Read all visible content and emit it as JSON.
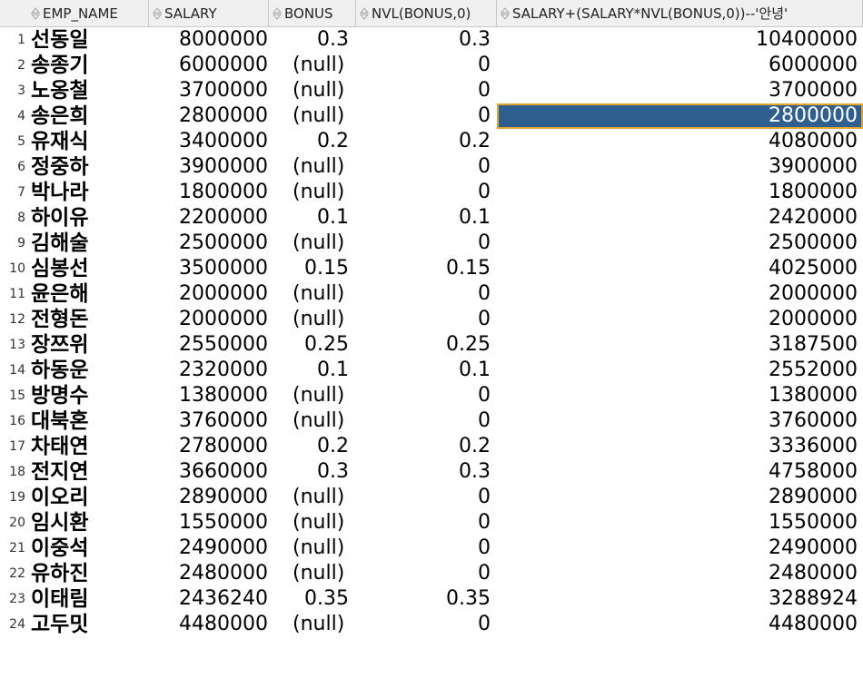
{
  "columns": [
    {
      "key": "name",
      "label": "EMP_NAME"
    },
    {
      "key": "salary",
      "label": "SALARY"
    },
    {
      "key": "bonus",
      "label": "BONUS"
    },
    {
      "key": "nvl",
      "label": "NVL(BONUS,0)"
    },
    {
      "key": "expr",
      "label": "SALARY+(SALARY*NVL(BONUS,0))--'안녕'"
    }
  ],
  "selected_row": 4,
  "rows": [
    {
      "num": "1",
      "name": "선동일",
      "salary": "8000000",
      "bonus": "0.3",
      "nvl": "0.3",
      "expr": "10400000"
    },
    {
      "num": "2",
      "name": "송종기",
      "salary": "6000000",
      "bonus": "(null)",
      "nvl": "0",
      "expr": "6000000"
    },
    {
      "num": "3",
      "name": "노옹철",
      "salary": "3700000",
      "bonus": "(null)",
      "nvl": "0",
      "expr": "3700000"
    },
    {
      "num": "4",
      "name": "송은희",
      "salary": "2800000",
      "bonus": "(null)",
      "nvl": "0",
      "expr": "2800000"
    },
    {
      "num": "5",
      "name": "유재식",
      "salary": "3400000",
      "bonus": "0.2",
      "nvl": "0.2",
      "expr": "4080000"
    },
    {
      "num": "6",
      "name": "정중하",
      "salary": "3900000",
      "bonus": "(null)",
      "nvl": "0",
      "expr": "3900000"
    },
    {
      "num": "7",
      "name": "박나라",
      "salary": "1800000",
      "bonus": "(null)",
      "nvl": "0",
      "expr": "1800000"
    },
    {
      "num": "8",
      "name": "하이유",
      "salary": "2200000",
      "bonus": "0.1",
      "nvl": "0.1",
      "expr": "2420000"
    },
    {
      "num": "9",
      "name": "김해술",
      "salary": "2500000",
      "bonus": "(null)",
      "nvl": "0",
      "expr": "2500000"
    },
    {
      "num": "10",
      "name": "심봉선",
      "salary": "3500000",
      "bonus": "0.15",
      "nvl": "0.15",
      "expr": "4025000"
    },
    {
      "num": "11",
      "name": "윤은해",
      "salary": "2000000",
      "bonus": "(null)",
      "nvl": "0",
      "expr": "2000000"
    },
    {
      "num": "12",
      "name": "전형돈",
      "salary": "2000000",
      "bonus": "(null)",
      "nvl": "0",
      "expr": "2000000"
    },
    {
      "num": "13",
      "name": "장쯔위",
      "salary": "2550000",
      "bonus": "0.25",
      "nvl": "0.25",
      "expr": "3187500"
    },
    {
      "num": "14",
      "name": "하동운",
      "salary": "2320000",
      "bonus": "0.1",
      "nvl": "0.1",
      "expr": "2552000"
    },
    {
      "num": "15",
      "name": "방명수",
      "salary": "1380000",
      "bonus": "(null)",
      "nvl": "0",
      "expr": "1380000"
    },
    {
      "num": "16",
      "name": "대북혼",
      "salary": "3760000",
      "bonus": "(null)",
      "nvl": "0",
      "expr": "3760000"
    },
    {
      "num": "17",
      "name": "차태연",
      "salary": "2780000",
      "bonus": "0.2",
      "nvl": "0.2",
      "expr": "3336000"
    },
    {
      "num": "18",
      "name": "전지연",
      "salary": "3660000",
      "bonus": "0.3",
      "nvl": "0.3",
      "expr": "4758000"
    },
    {
      "num": "19",
      "name": "이오리",
      "salary": "2890000",
      "bonus": "(null)",
      "nvl": "0",
      "expr": "2890000"
    },
    {
      "num": "20",
      "name": "임시환",
      "salary": "1550000",
      "bonus": "(null)",
      "nvl": "0",
      "expr": "1550000"
    },
    {
      "num": "21",
      "name": "이중석",
      "salary": "2490000",
      "bonus": "(null)",
      "nvl": "0",
      "expr": "2490000"
    },
    {
      "num": "22",
      "name": "유하진",
      "salary": "2480000",
      "bonus": "(null)",
      "nvl": "0",
      "expr": "2480000"
    },
    {
      "num": "23",
      "name": "이태림",
      "salary": "2436240",
      "bonus": "0.35",
      "nvl": "0.35",
      "expr": "3288924"
    },
    {
      "num": "24",
      "name": "고두밋",
      "salary": "4480000",
      "bonus": "(null)",
      "nvl": "0",
      "expr": "4480000"
    }
  ]
}
